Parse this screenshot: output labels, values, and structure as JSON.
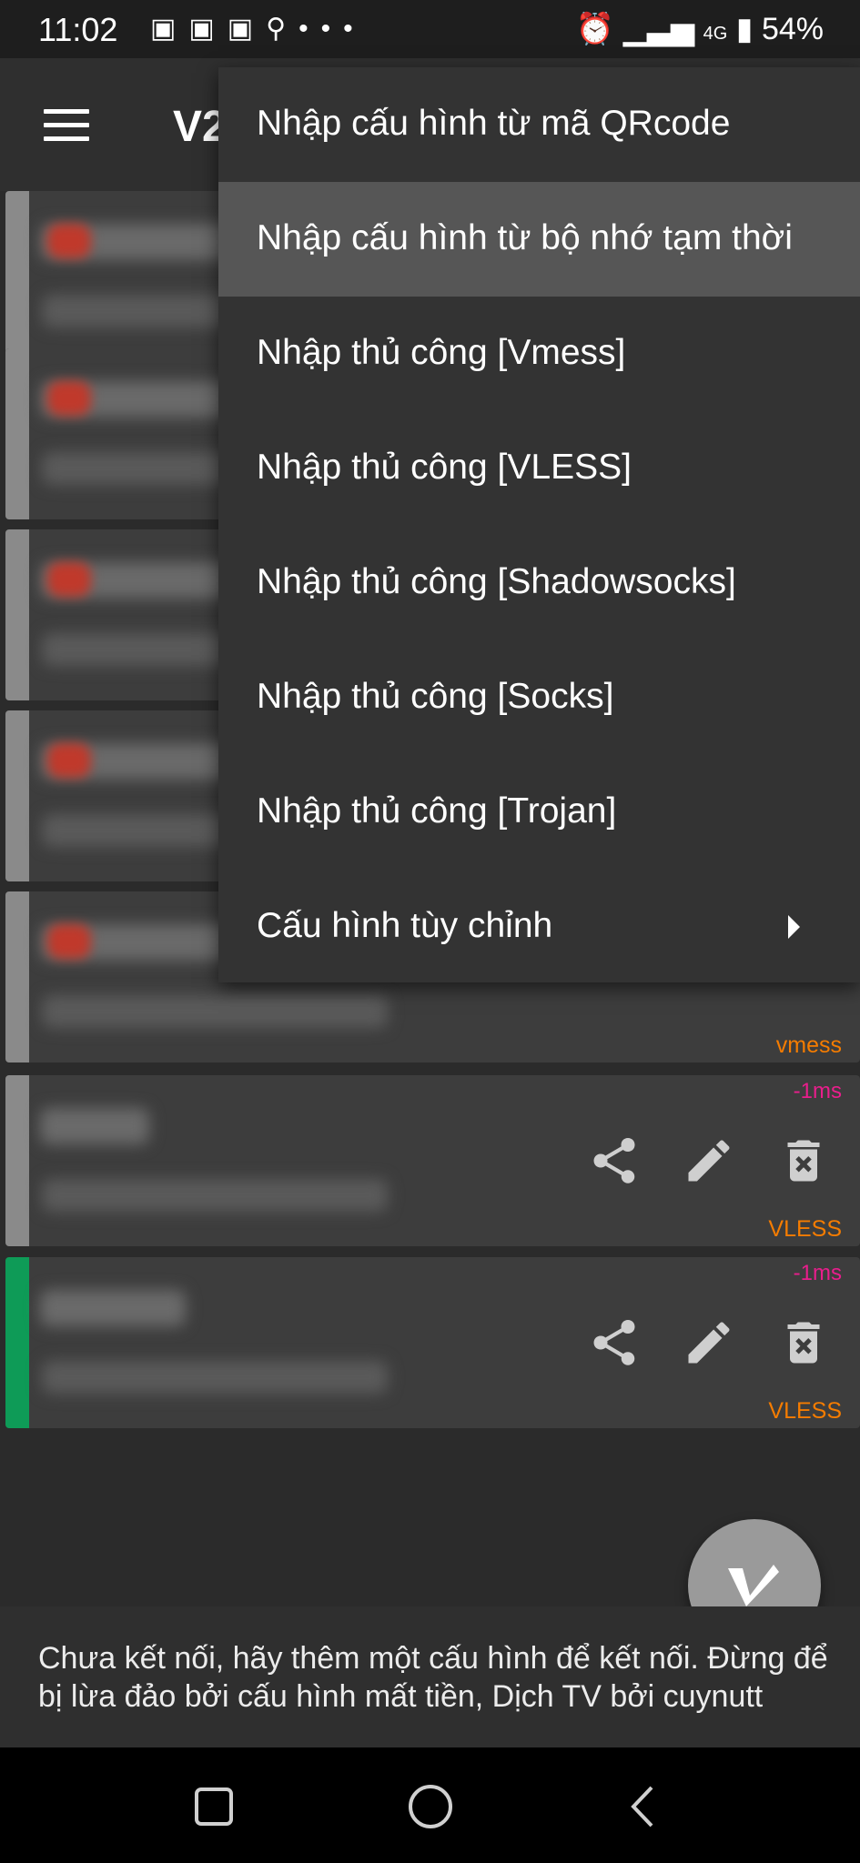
{
  "status_bar": {
    "time": "11:02",
    "battery": "54%",
    "network": "4G",
    "notifications": [
      "discord-icon",
      "discord-icon",
      "discord-icon",
      "add-user-icon",
      "more-icon"
    ]
  },
  "app_bar": {
    "title": "V2"
  },
  "dropdown_menu": {
    "items": [
      {
        "label": "Nhập cấu hình từ mã QRcode"
      },
      {
        "label": "Nhập cấu hình từ bộ nhớ tạm thời"
      },
      {
        "label": "Nhập thủ công [Vmess]"
      },
      {
        "label": "Nhập thủ công [VLESS]"
      },
      {
        "label": "Nhập thủ công [Shadowsocks]"
      },
      {
        "label": "Nhập thủ công [Socks]"
      },
      {
        "label": "Nhập thủ công [Trojan]"
      },
      {
        "label": "Cấu hình tùy chỉnh"
      }
    ]
  },
  "servers": [
    {
      "latency": "",
      "protocol": ""
    },
    {
      "latency": "",
      "protocol": ""
    },
    {
      "latency": "",
      "protocol": ""
    },
    {
      "latency": "",
      "protocol": ""
    },
    {
      "latency": "",
      "protocol": "vmess"
    },
    {
      "latency": "-1ms",
      "protocol": "VLESS"
    },
    {
      "latency": "-1ms",
      "protocol": "VLESS"
    }
  ],
  "footer": {
    "message": "Chưa kết nối, hãy thêm một cấu hình để kết nối. Đừng để bị lừa đảo bởi cấu hình mất tiền, Dịch TV bởi cuynutt"
  },
  "colors": {
    "accent_active": "#0e9b57",
    "latency": "#e91e8c",
    "protocol": "#f57c00"
  }
}
